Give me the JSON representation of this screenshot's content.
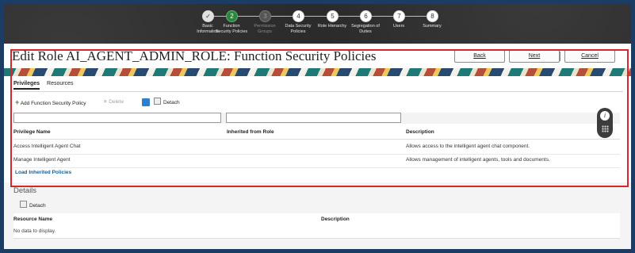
{
  "train": {
    "stops": [
      {
        "num": "✓",
        "label": "Basic\nInformation",
        "state": "done"
      },
      {
        "num": "2",
        "label": "Function\nSecurity Policies",
        "state": "current"
      },
      {
        "num": "3",
        "label": "Permission\nGroups",
        "state": "disabled"
      },
      {
        "num": "4",
        "label": "Data Security\nPolicies",
        "state": "todo"
      },
      {
        "num": "5",
        "label": "Role Hierarchy",
        "state": "todo"
      },
      {
        "num": "6",
        "label": "Segregation of\nDuties",
        "state": "todo"
      },
      {
        "num": "7",
        "label": "Users",
        "state": "todo"
      },
      {
        "num": "8",
        "label": "Summary",
        "state": "todo"
      }
    ]
  },
  "header": {
    "title": "Edit Role AI_AGENT_ADMIN_ROLE: Function Security Policies",
    "back": "Back",
    "next": "Next",
    "cancel": "Cancel"
  },
  "tabs": {
    "privileges": "Privileges",
    "resources": "Resources"
  },
  "toolbar": {
    "add": "Add Function Security Policy",
    "delete": "Delete",
    "detach": "Detach"
  },
  "grid": {
    "columns": [
      "Privilege Name",
      "Inherited from Role",
      "Description"
    ],
    "rows": [
      [
        "Access Intelligent Agent Chat",
        "",
        "Allows access to the intelligent agent chat component."
      ],
      [
        "Manage Intelligent Agent",
        "",
        "Allows management of intelligent agents, tools and documents."
      ]
    ],
    "load_link": "Load Inherited Policies"
  },
  "details": {
    "title": "Details",
    "detach": "Detach",
    "columns": [
      "Resource Name",
      "Description"
    ],
    "empty": "No data to display."
  },
  "colors": {
    "current_step": "#2e8540",
    "highlight": "#d9262e",
    "link": "#1a5f8e",
    "edit_icon": "#2f7fd0"
  }
}
